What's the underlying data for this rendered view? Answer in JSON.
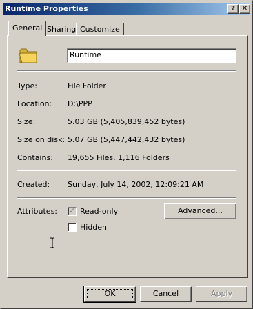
{
  "window": {
    "title": "Runtime Properties",
    "help_glyph": "?",
    "close_glyph": "✕"
  },
  "tabs": [
    {
      "label": "General",
      "active": true
    },
    {
      "label": "Sharing",
      "active": false
    },
    {
      "label": "Customize",
      "active": false
    }
  ],
  "general": {
    "name_value": "Runtime",
    "fields": [
      {
        "label": "Type:",
        "value": "File Folder"
      },
      {
        "label": "Location:",
        "value": "D:\\PPP"
      },
      {
        "label": "Size:",
        "value": "5.03 GB (5,405,839,452 bytes)"
      },
      {
        "label": "Size on disk:",
        "value": "5.07 GB (5,447,442,432 bytes)"
      },
      {
        "label": "Contains:",
        "value": "19,655 Files, 1,116 Folders"
      }
    ],
    "created": {
      "label": "Created:",
      "value": "Sunday, July 14, 2002, 12:09:21 AM"
    },
    "attributes": {
      "label": "Attributes:",
      "read_only": {
        "label": "Read-only",
        "checked": true,
        "disabled": true
      },
      "hidden": {
        "label": "Hidden",
        "checked": false
      },
      "advanced_label": "Advanced..."
    }
  },
  "footer": {
    "ok_label": "OK",
    "cancel_label": "Cancel",
    "apply_label": "Apply",
    "apply_enabled": false
  },
  "colors": {
    "face": "#d4d0c8",
    "titlebar_start": "#0a246a",
    "titlebar_end": "#a6caf0",
    "folder": "#f5d35c"
  }
}
